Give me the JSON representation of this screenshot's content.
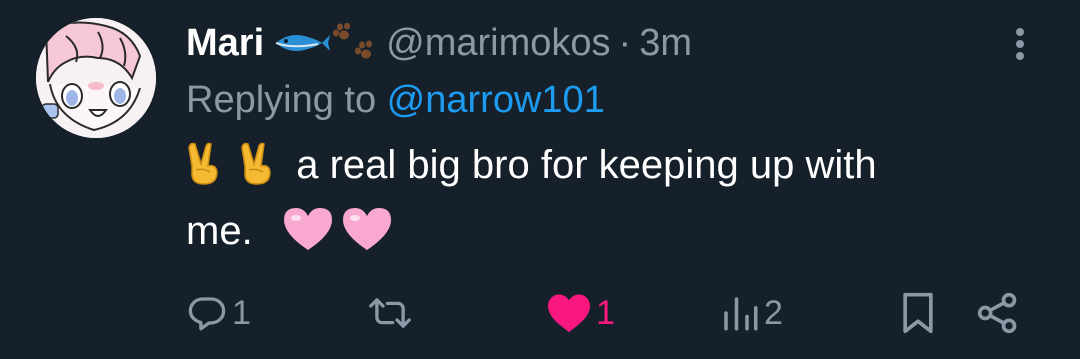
{
  "tweet": {
    "author": {
      "display_name": "Mari",
      "name_emojis": [
        "fish-icon",
        "paw-prints-icon"
      ],
      "handle": "@marimokos",
      "separator": "·",
      "time": "3m"
    },
    "reply": {
      "prefix": "Replying to ",
      "mention": "@narrow101"
    },
    "body": {
      "leading_emojis": [
        "victory-hand-icon",
        "victory-hand-icon"
      ],
      "text_line1": "a real big bro for keeping up with",
      "text_line2": "me.",
      "trailing_emojis": [
        "pink-heart-icon",
        "pink-heart-icon"
      ]
    },
    "actions": {
      "reply_count": "1",
      "retweet_count": "",
      "like_count": "1",
      "liked": true,
      "views_count": "2"
    },
    "colors": {
      "background": "#15202b",
      "muted_text": "#8b98a5",
      "link": "#1d9bf0",
      "like_active": "#f91880"
    }
  }
}
